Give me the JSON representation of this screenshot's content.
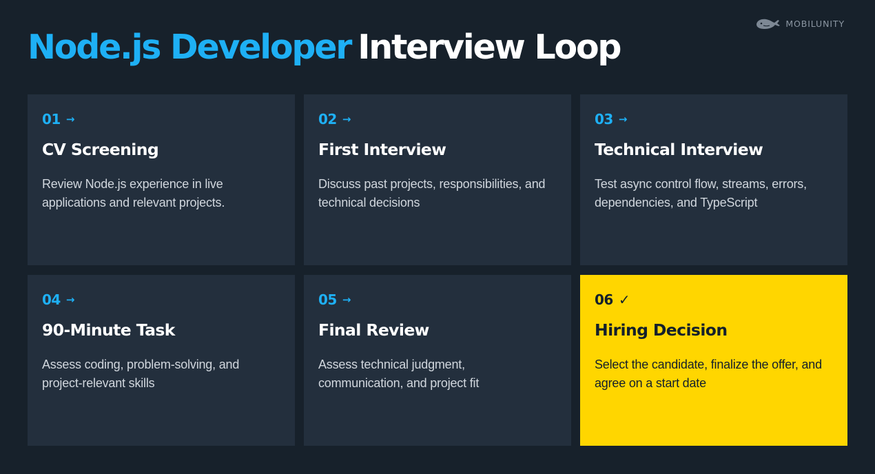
{
  "logo": {
    "text": "MOBILUNITY",
    "icon": "whale-icon"
  },
  "title": {
    "accent": "Node.js Developer",
    "rest": "Interview Loop"
  },
  "colors": {
    "background": "#17212b",
    "card": "#232f3d",
    "accent": "#1eb0f5",
    "highlight": "#ffd600"
  },
  "steps": [
    {
      "number": "01",
      "icon": "→",
      "title": "CV Screening",
      "description": "Review Node.js experience in live applications and relevant projects."
    },
    {
      "number": "02",
      "icon": "→",
      "title": "First Interview",
      "description": "Discuss past projects, responsibilities, and technical decisions"
    },
    {
      "number": "03",
      "icon": "→",
      "title": "Technical Interview",
      "description": "Test async control flow, streams, errors, dependencies, and TypeScript"
    },
    {
      "number": "04",
      "icon": "→",
      "title": "90-Minute Task",
      "description": "Assess coding, problem-solving, and project-relevant skills"
    },
    {
      "number": "05",
      "icon": "→",
      "title": "Final Review",
      "description": "Assess technical judgment, communication, and project fit"
    },
    {
      "number": "06",
      "icon": "✓",
      "title": "Hiring Decision",
      "description": "Select the candidate, finalize the offer, and agree on a start date"
    }
  ]
}
